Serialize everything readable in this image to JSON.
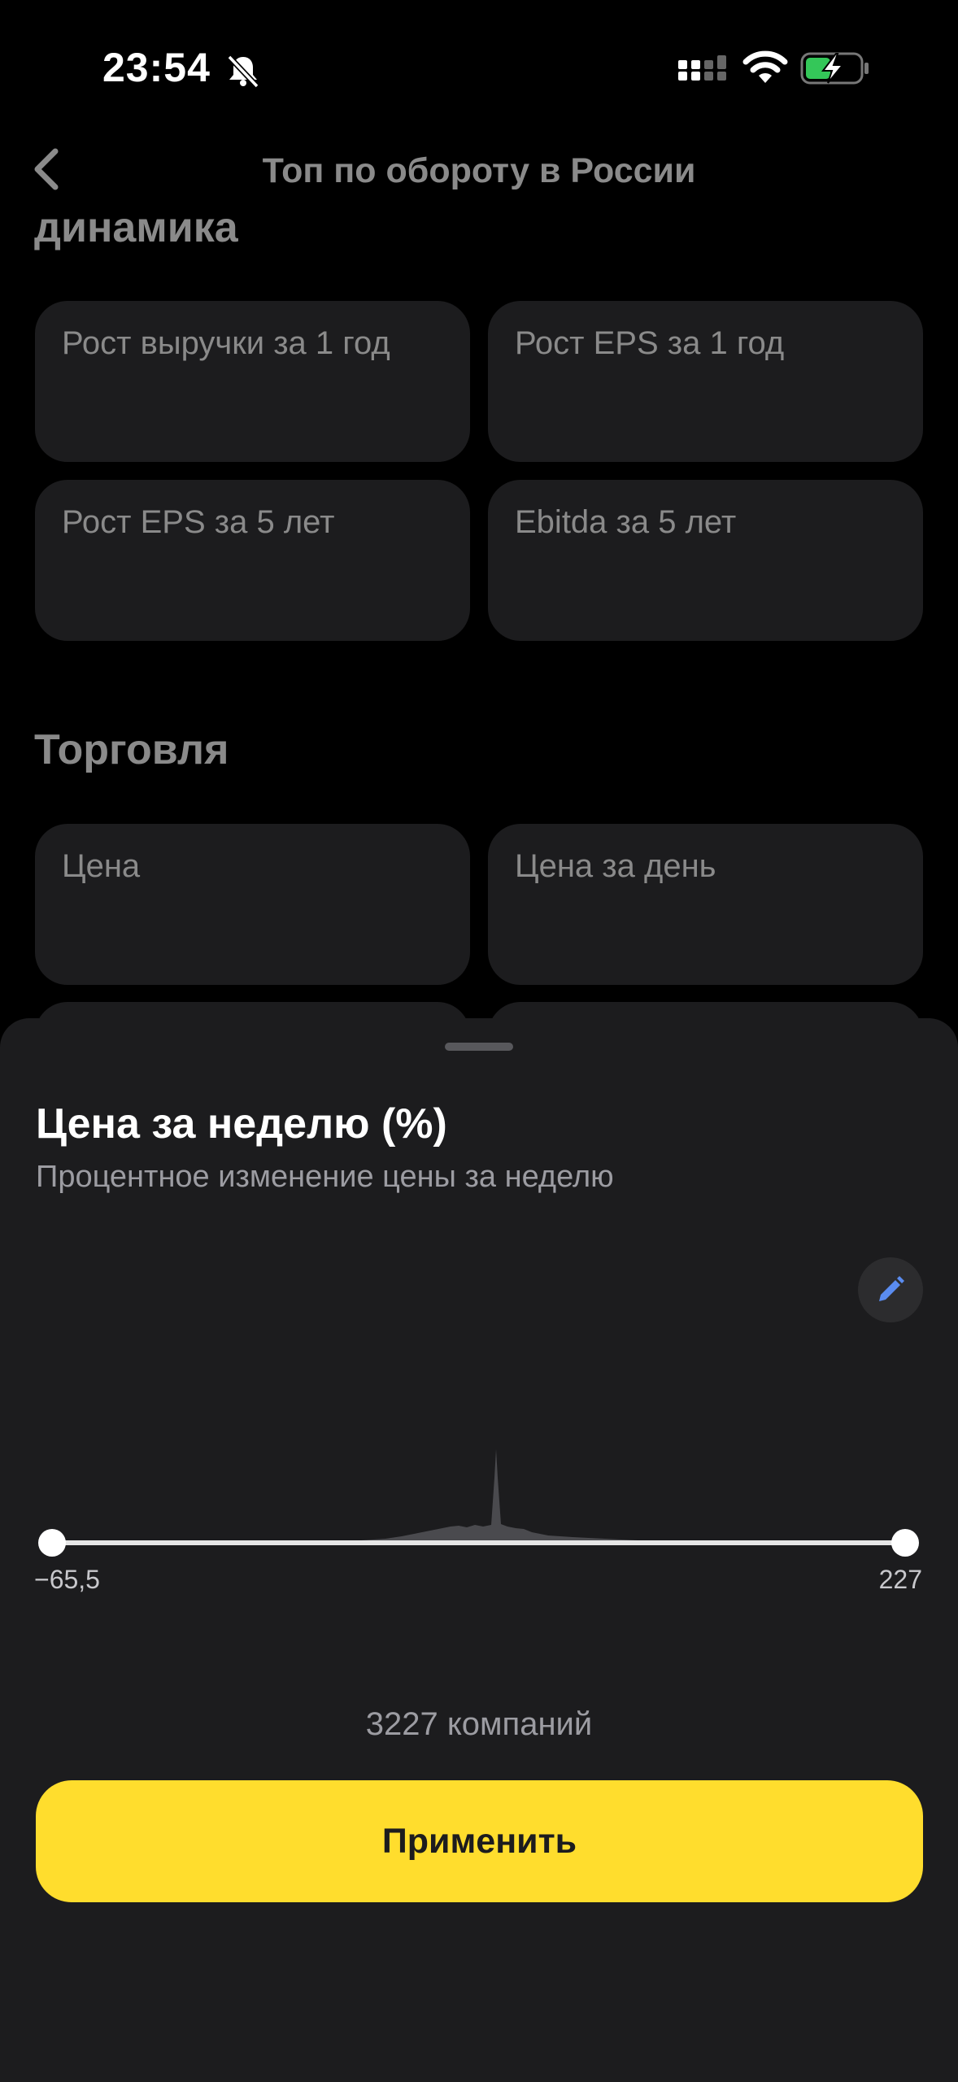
{
  "status_bar": {
    "time": "23:54",
    "icons": [
      "bell-slash-icon",
      "cellular-signal-icon",
      "wifi-icon",
      "battery-charging-icon"
    ]
  },
  "background_page": {
    "back_icon": "chevron-left-icon",
    "title": "Топ по обороту в России",
    "sections": [
      {
        "heading": "динамика",
        "cards": [
          "Рост выручки за 1 год",
          "Рост EPS за 1 год",
          "Рост EPS за 5 лет",
          "Ebitda за 5 лет"
        ]
      },
      {
        "heading": "Торговля",
        "cards": [
          "Цена",
          "Цена за день"
        ]
      }
    ]
  },
  "sheet": {
    "title": "Цена за неделю (%)",
    "subtitle": "Процентное изменение цены за неделю",
    "edit_icon": "pencil-icon",
    "range": {
      "min_label": "−65,5",
      "max_label": "227",
      "min": -65.5,
      "max": 227
    },
    "companies_count": "3227 компаний",
    "apply_label": "Применить"
  },
  "colors": {
    "accent_yellow": "#ffdd2d",
    "sheet_bg": "#1c1c1e",
    "card_bg": "#1c1c1e",
    "dim_text": "#8a8a8a",
    "edit_icon_blue": "#5a8cf0"
  }
}
